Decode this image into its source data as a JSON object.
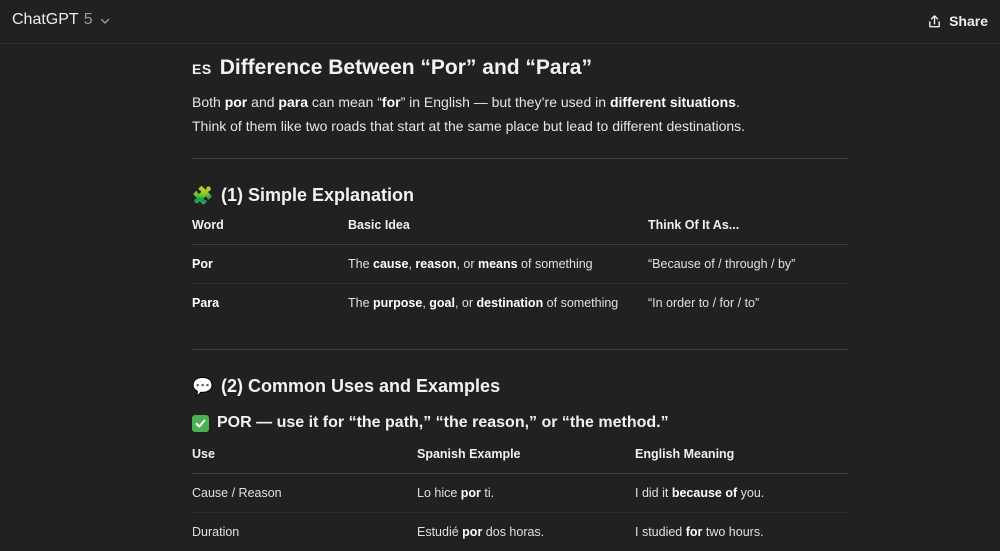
{
  "header": {
    "model_name": "ChatGPT",
    "model_version": "5",
    "share_label": "Share"
  },
  "article": {
    "flag": "ES",
    "title": "Difference Between “Por” and “Para”",
    "intro_line1_html": "Both <b>por</b> and <b>para</b> can mean “<b>for</b>” in English — but they’re used in <b>different situations</b>.",
    "intro_line2": "Think of them like two roads that start at the same place but lead to different destinations."
  },
  "section1": {
    "emoji": "🧩",
    "heading": "(1) Simple Explanation",
    "columns": [
      "Word",
      "Basic Idea",
      "Think Of It As..."
    ],
    "rows": [
      {
        "word": "Por",
        "idea_html": "The <b>cause</b>, <b>reason</b>, or <b>means</b> of something",
        "think": "“Because of / through / by”"
      },
      {
        "word": "Para",
        "idea_html": "The <b>purpose</b>, <b>goal</b>, or <b>destination</b> of something",
        "think": "“In order to / for / to”"
      }
    ]
  },
  "section2": {
    "emoji": "💬",
    "heading": "(2) Common Uses and Examples",
    "subheading": "POR — use it for “the path,” “the reason,” or “the method.”",
    "columns": [
      "Use",
      "Spanish Example",
      "English Meaning"
    ],
    "rows": [
      {
        "use": "Cause / Reason",
        "spanish_html": "Lo hice <b>por</b> ti.",
        "english_html": "I did it <b>because of</b> you."
      },
      {
        "use": "Duration",
        "spanish_html": "Estudié <b>por</b> dos horas.",
        "english_html": "I studied <b>for</b> two hours."
      }
    ]
  }
}
